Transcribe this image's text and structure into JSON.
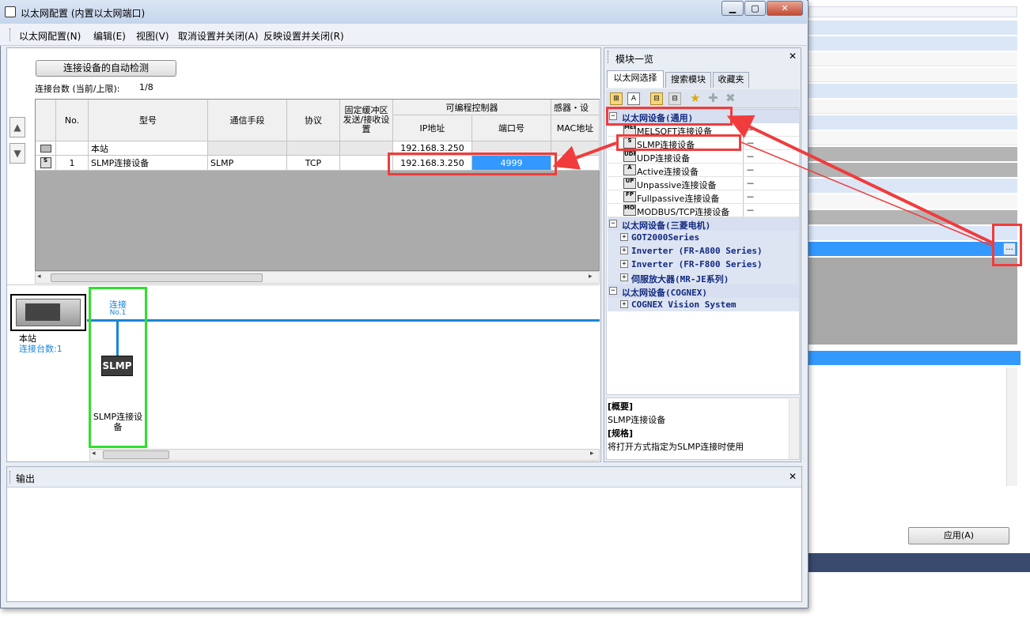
{
  "window": {
    "title": "以太网配置 (内置以太网端口)",
    "minimize": "▁",
    "maximize": "▢",
    "close": "✕"
  },
  "menu": [
    "以太网配置(N)",
    "编辑(E)",
    "视图(V)",
    "取消设置并关闭(A)",
    "反映设置并关闭(R)"
  ],
  "toolbar": {
    "auto_detect": "连接设备的自动检测",
    "conn_count_label": "连接台数 (当前/上限):",
    "conn_count_value": "1/8"
  },
  "table": {
    "headers": {
      "no": "No.",
      "model": "型号",
      "comm": "通信手段",
      "protocol": "协议",
      "fixed_buffer": "固定缓冲区发送/接收设置",
      "plc_group": "可编程控制器",
      "ip": "IP地址",
      "port": "端口号",
      "sensor_group": "感器・设",
      "mac": "MAC地址"
    },
    "rows": [
      {
        "no": "",
        "model": "本站",
        "comm": "",
        "protocol": "",
        "fixed": "",
        "ip": "192.168.3.250",
        "port": ""
      },
      {
        "no": "1",
        "model": "SLMP连接设备",
        "comm": "SLMP",
        "protocol": "TCP",
        "fixed": "",
        "ip": "192.168.3.250",
        "port": "4999"
      }
    ],
    "row_icons": [
      "station-icon",
      "slmp-device-icon"
    ]
  },
  "diagram": {
    "station_label": "本站",
    "station_count": "连接台数:1",
    "conn_label": "连接",
    "conn_no": "No.1",
    "device_block": "SLMP",
    "device_label": "SLMP连接设备"
  },
  "module_list": {
    "title": "模块一览",
    "close": "✕",
    "tabs": [
      "以太网选择",
      "搜索模块",
      "收藏夹"
    ],
    "groups": [
      {
        "label": "以太网设备(通用)",
        "items": [
          {
            "label": "MELSOFT连接设备",
            "value": "－",
            "icon": "MEL"
          },
          {
            "label": "SLMP连接设备",
            "value": "－",
            "icon": "S"
          },
          {
            "label": "UDP连接设备",
            "value": "－",
            "icon": "UDP"
          },
          {
            "label": "Active连接设备",
            "value": "－",
            "icon": "A"
          },
          {
            "label": "Unpassive连接设备",
            "value": "－",
            "icon": "UP"
          },
          {
            "label": "Fullpassive连接设备",
            "value": "－",
            "icon": "FP"
          },
          {
            "label": "MODBUS/TCP连接设备",
            "value": "－",
            "icon": "MOD"
          }
        ]
      },
      {
        "label": "以太网设备(三菱电机)",
        "subgroups": [
          "GOT2000Series",
          "Inverter (FR-A800 Series)",
          "Inverter (FR-F800 Series)",
          "伺服放大器(MR-JE系列)"
        ]
      },
      {
        "label": "以太网设备(COGNEX)",
        "subgroups": [
          "COGNEX Vision System"
        ]
      }
    ],
    "desc": {
      "summary_title": "[概要]",
      "summary": "SLMP连接设备",
      "spec_title": "[规格]",
      "spec": "将打开方式指定为SLMP连接时使用"
    }
  },
  "output": {
    "title": "输出",
    "close": "✕"
  },
  "background_window": {
    "apply_button": "应用(A)",
    "dots_button": "..."
  },
  "colors": {
    "annotation_red": "#f03c3c",
    "network_blue": "#1a86d8",
    "selection_blue": "#3399ff",
    "highlight_green": "#2ee02e"
  }
}
